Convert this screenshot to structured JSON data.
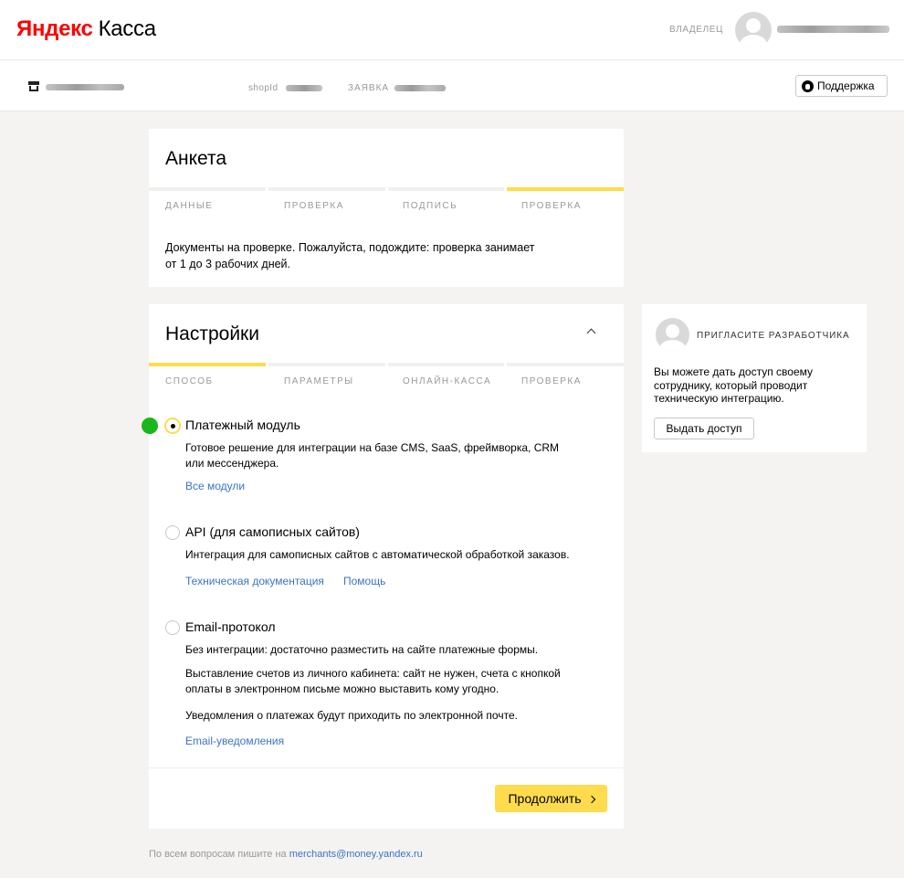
{
  "header": {
    "logo_brand": "Яндекс",
    "logo_product": "Касса",
    "owner_label": "ВЛАДЕЛЕЦ"
  },
  "subheader": {
    "shopid_label": "shopId",
    "zayavka_label": "ЗАЯВКА",
    "support_label": "Поддержка"
  },
  "anketa": {
    "title": "Анкета",
    "steps": [
      {
        "label": "ДАННЫЕ",
        "active": false
      },
      {
        "label": "ПРОВЕРКА",
        "active": false
      },
      {
        "label": "ПОДПИСЬ",
        "active": false
      },
      {
        "label": "ПРОВЕРКА",
        "active": true
      }
    ],
    "message_line1": "Документы на проверке. Пожалуйста, подождите: проверка занимает",
    "message_line2": "от 1 до 3 рабочих дней."
  },
  "settings": {
    "title": "Настройки",
    "steps": [
      {
        "label": "СПОСОБ",
        "active": true
      },
      {
        "label": "ПАРАМЕТРЫ",
        "active": false
      },
      {
        "label": "ОНЛАЙН-КАССА",
        "active": false
      },
      {
        "label": "ПРОВЕРКА",
        "active": false
      }
    ],
    "options": [
      {
        "title": "Платежный модуль",
        "selected": true,
        "desc_line1": "Готовое решение для интеграции на базе CMS, SaaS, фреймворка, CRM",
        "desc_line2": "или мессенджера.",
        "link1": "Все модули"
      },
      {
        "title": "API (для самописных сайтов)",
        "selected": false,
        "desc_line1": "Интеграция для самописных сайтов с автоматической обработкой заказов.",
        "link1": "Техническая документация",
        "link2": "Помощь"
      },
      {
        "title": "Email-протокол",
        "selected": false,
        "desc1": "Без интеграции: достаточно разместить на сайте платежные формы.",
        "desc2_line1": "Выставление счетов из личного кабинета: сайт не нужен, счета с кнопкой",
        "desc2_line2": "оплаты в электронном письме можно выставить кому угодно.",
        "desc3": "Уведомления о платежах будут приходить по электронной почте.",
        "link1": "Email-уведомления"
      }
    ],
    "continue_label": "Продолжить"
  },
  "invite": {
    "title": "ПРИГЛАСИТЕ РАЗРАБОТЧИКА",
    "text_line1": "Вы можете дать доступ своему",
    "text_line2": "сотруднику, который проводит",
    "text_line3": "техническую интеграцию.",
    "button_label": "Выдать доступ"
  },
  "footer": {
    "text": "По всем вопросам пишите на",
    "email": "merchants@money.yandex.ru"
  },
  "colors": {
    "accent": "#ffdb4d",
    "link": "#3b73c7",
    "status_ok": "#1bb61b",
    "logo_red": "#ff0000"
  }
}
